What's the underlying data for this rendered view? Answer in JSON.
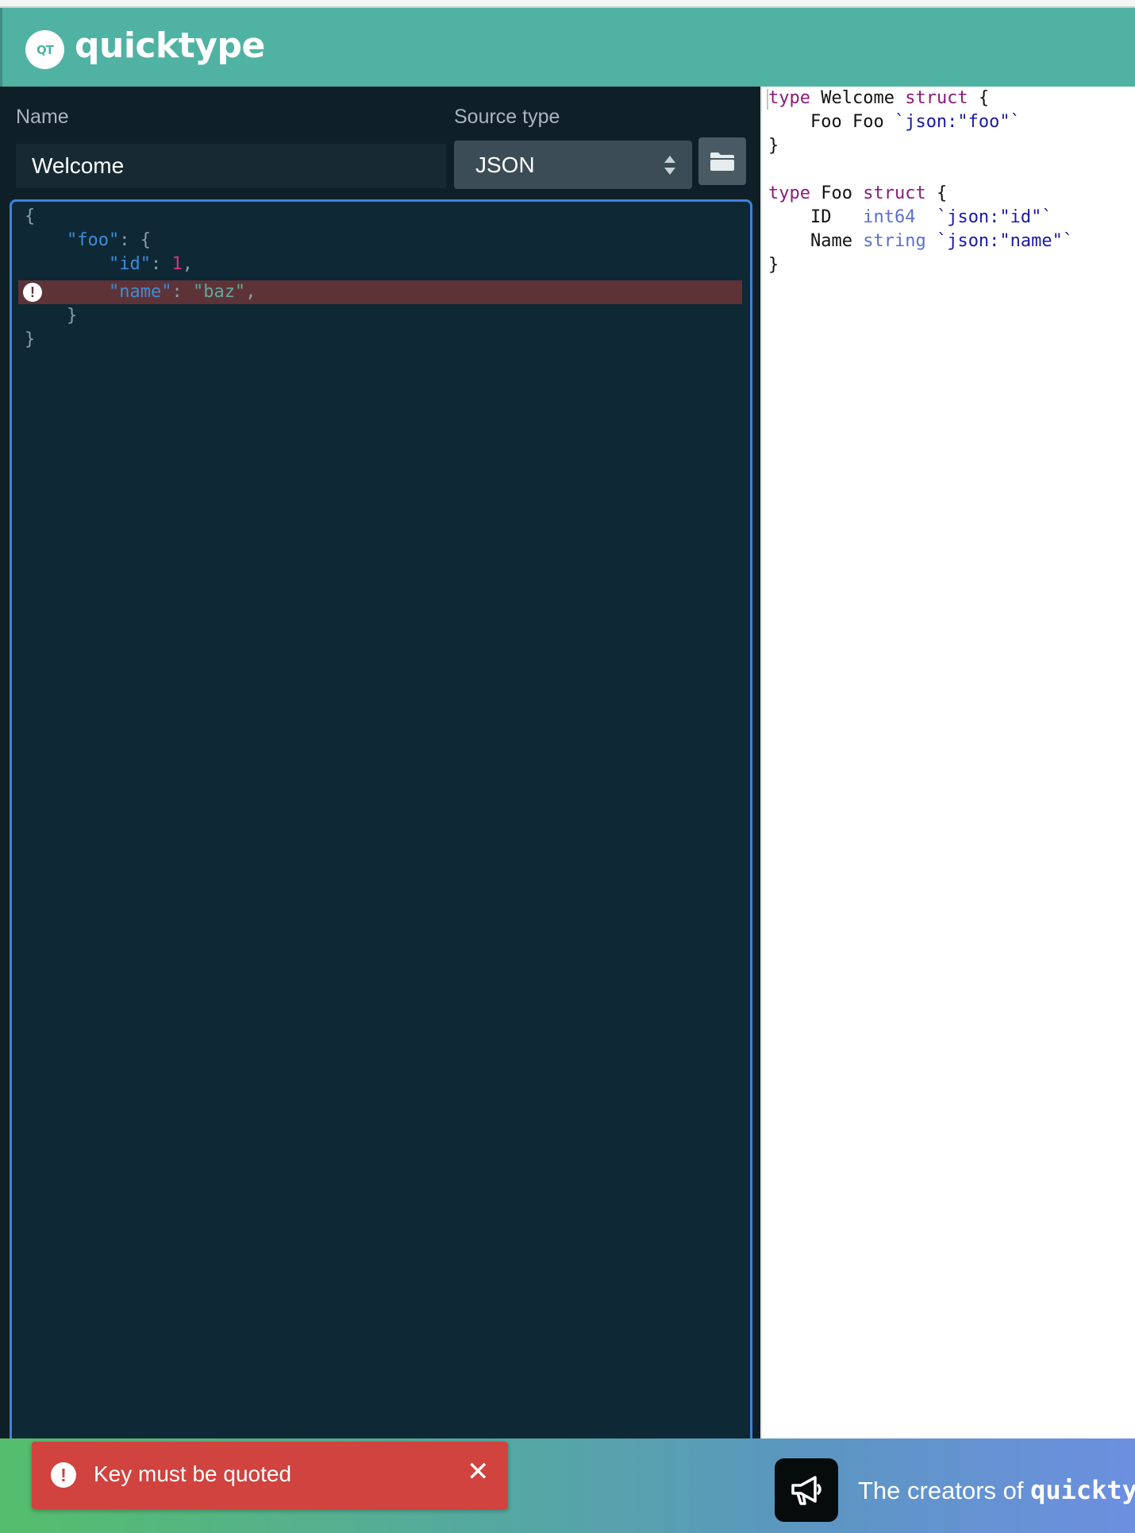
{
  "header": {
    "logo_text": "QT",
    "brand": "quicktype"
  },
  "form": {
    "name_label": "Name",
    "name_value": "Welcome",
    "source_type_label": "Source type",
    "source_type_value": "JSON"
  },
  "editor": {
    "lines": [
      {
        "p1": "{"
      },
      {
        "k": "\"foo\"",
        "p1": ": {"
      },
      {
        "k": "\"id\"",
        "p1": ": ",
        "n": "1",
        "p2": ","
      },
      {
        "k": "\"name\"",
        "p1": ": ",
        "s": "\"baz\"",
        "p2": ","
      },
      {
        "p1": "}"
      },
      {
        "p1": "}"
      }
    ],
    "error_line_index": 3
  },
  "output": {
    "lines": [
      {
        "kw1": "type",
        "t1": " Welcome ",
        "kw2": "struct",
        "t2": " {"
      },
      {
        "t1": "    Foo Foo ",
        "tg": "`json:\"foo\"`"
      },
      {
        "t1": "}"
      },
      {
        "t1": ""
      },
      {
        "kw1": "type",
        "t1": " Foo ",
        "kw2": "struct",
        "t2": " {"
      },
      {
        "t1": "    ID   ",
        "ty": "int64",
        "t2": "  ",
        "tg": "`json:\"id\"`"
      },
      {
        "t1": "    Name ",
        "ty": "string",
        "t2": " ",
        "tg": "`json:\"name\"`"
      },
      {
        "t1": "}"
      }
    ]
  },
  "toast": {
    "message": "Key must be quoted",
    "close": "✕"
  },
  "promo": {
    "text": "The creators of ",
    "brand": "quickty"
  }
}
